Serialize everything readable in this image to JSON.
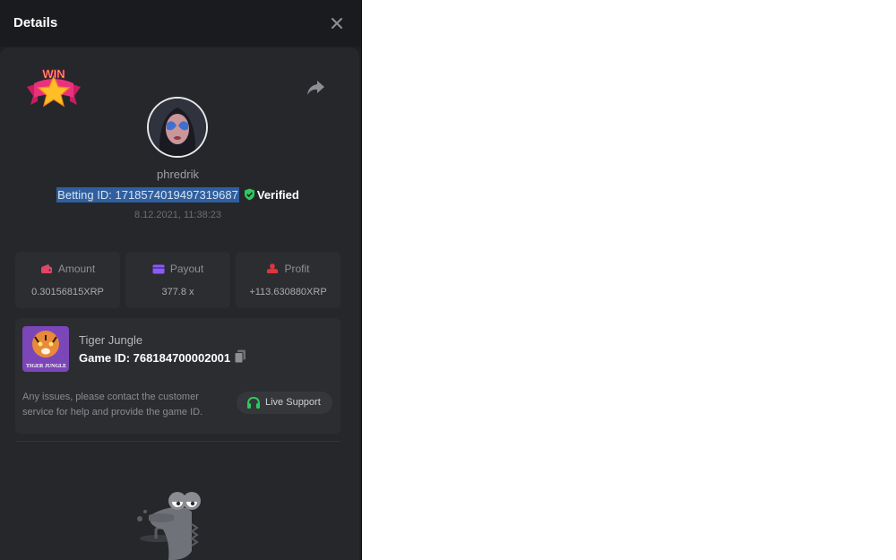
{
  "modal": {
    "title": "Details"
  },
  "badge": {
    "text": "WIN"
  },
  "player": {
    "username": "phredrik",
    "betting_id": "Betting ID: 1718574019497319687",
    "verified_label": "Verified",
    "timestamp": "8.12.2021, 11:38:23"
  },
  "stats": [
    {
      "label": "Amount",
      "value": "0.30156815XRP",
      "icon": "wallet-icon",
      "color": "#e0456a"
    },
    {
      "label": "Payout",
      "value": "377.8 x",
      "icon": "card-icon",
      "color": "#8a5cf5"
    },
    {
      "label": "Profit",
      "value": "+113.630880XRP",
      "icon": "coins-icon",
      "color": "#e0343c"
    }
  ],
  "game": {
    "name": "Tiger Jungle",
    "game_id": "Game ID: 768184700002001",
    "help_text": "Any issues, please contact the customer service for help and provide the game ID.",
    "support_label": "Live Support",
    "thumb_text": "TIGER JUNGLE"
  },
  "colors": {
    "background": "#1f2023",
    "card": "#2c2d31",
    "verified": "#2ec95c",
    "selection": "#2f5f9e"
  },
  "icons": [
    "close-icon",
    "share-icon",
    "shield-check-icon",
    "copy-icon",
    "headset-icon"
  ]
}
